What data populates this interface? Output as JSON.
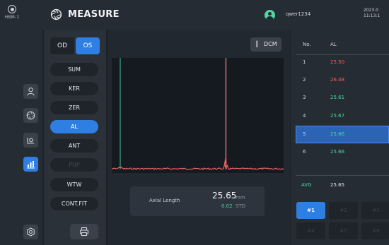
{
  "header": {
    "logo_label": "HBM-1",
    "title": "MEASURE",
    "username": "qwer1234",
    "date_line1": "2023.0",
    "date_line2": "11:13:1"
  },
  "eyes": {
    "od": "OD",
    "os": "OS",
    "selected": "OS"
  },
  "params": [
    {
      "label": "SUM",
      "state": "normal"
    },
    {
      "label": "KER",
      "state": "normal"
    },
    {
      "label": "ZER",
      "state": "normal"
    },
    {
      "label": "AL",
      "state": "active"
    },
    {
      "label": "ANT",
      "state": "normal"
    },
    {
      "label": "PUP",
      "state": "disabled"
    },
    {
      "label": "WTW",
      "state": "normal"
    },
    {
      "label": "CONT.FIT",
      "state": "normal"
    }
  ],
  "graph": {
    "dcm_label": "DCM",
    "result_label": "Axial Length",
    "result_value": "25.65",
    "result_unit": "mm",
    "std_value": "0.02",
    "std_label": "STD"
  },
  "table": {
    "col_no": "No.",
    "col_al": "AL",
    "rows": [
      {
        "no": "1",
        "value": "25.50",
        "status": "red"
      },
      {
        "no": "2",
        "value": "26.48",
        "status": "red"
      },
      {
        "no": "3",
        "value": "25.61",
        "status": "green"
      },
      {
        "no": "4",
        "value": "25.67",
        "status": "green"
      },
      {
        "no": "5",
        "value": "25.66",
        "status": "green"
      },
      {
        "no": "6",
        "value": "25.66",
        "status": "green"
      }
    ],
    "selected_row": 5,
    "avg_label": "AVG",
    "avg_value": "25.65"
  },
  "slots": [
    "#1",
    "#2",
    "#3",
    "#4",
    "#5",
    "#6"
  ],
  "active_slot": "#1",
  "colors": {
    "accent": "#2f7fe2",
    "ok": "#4fd6a7",
    "error": "#ff5c5c",
    "signal": "#ff6b6b",
    "marker": "#4fd6a7"
  },
  "icons": {
    "logo": "hbm-logo-icon",
    "measure": "aperture-icon",
    "avatar": "user-avatar-icon",
    "rail": [
      "person-icon",
      "aperture-icon",
      "eye-scan-icon",
      "bar-chart-icon",
      "settings-icon"
    ],
    "dcm": "signal-icon",
    "print": "printer-icon"
  }
}
